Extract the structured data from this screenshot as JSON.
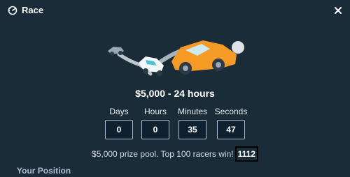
{
  "header": {
    "title": "Race",
    "icon": "race-icon",
    "close_icon": "close-icon"
  },
  "prize_heading": "$5,000 - 24 hours",
  "timer": [
    {
      "label": "Days",
      "value": "0"
    },
    {
      "label": "Hours",
      "value": "0"
    },
    {
      "label": "Minutes",
      "value": "35"
    },
    {
      "label": "Seconds",
      "value": "47"
    }
  ],
  "info": {
    "text": "$5,000 prize pool. Top 100 racers win!",
    "rank": "1112"
  },
  "section_title": "Your Position",
  "colors": {
    "background": "#1a2c38",
    "box_bg": "#0f212e",
    "car_orange": "#f59b25"
  }
}
